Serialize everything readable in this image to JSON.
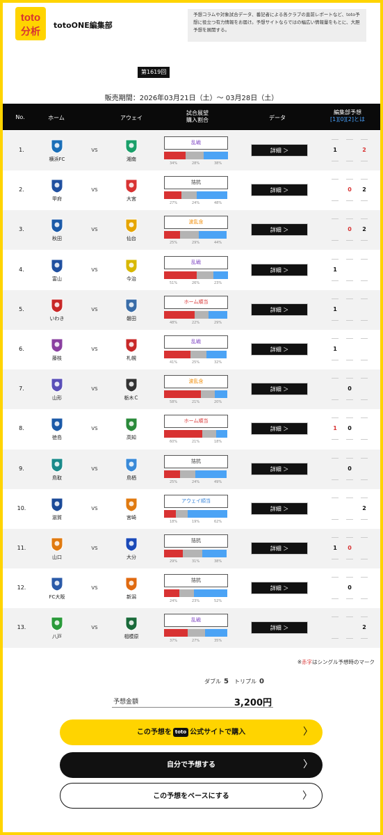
{
  "header": {
    "logo_text": "toto 分析",
    "brand": "totoONE編集部",
    "intro": "予想コラムや対象試合データ、番記者による各クラブの直前レポートなど、toto予想に役立つ有力情報をお届け。予想サイトならではの幅広い情報量をもとに、大胆予想を展開する。"
  },
  "round": "第1619回",
  "period": "販売期間：2026年03月21日（土）〜 03月28日（土）",
  "table_head": {
    "no": "No.",
    "home": "ホーム",
    "away": "アウェイ",
    "cond1": "試合展望",
    "cond2": "購入割合",
    "data": "データ",
    "pick1": "編集部予想",
    "pick2": "[1][0][2]とは"
  },
  "vs": "VS",
  "detail_label": "詳細 ＞",
  "matches": [
    {
      "no": "1.",
      "home": "横浜FC",
      "away": "湘南",
      "cond": "乱戦",
      "cond_color": "#7a3fc0",
      "pct": [
        34,
        28,
        38
      ],
      "picks": [
        "1",
        "",
        "2"
      ],
      "red": [
        false,
        false,
        true
      ],
      "home_color": "#1b6fb8",
      "away_color": "#1aa06a"
    },
    {
      "no": "2.",
      "home": "甲府",
      "away": "大宮",
      "cond": "拮抗",
      "cond_color": "#333333",
      "pct": [
        27,
        24,
        48
      ],
      "picks": [
        "",
        "0",
        "2"
      ],
      "red": [
        false,
        true,
        false
      ],
      "home_color": "#2050a0",
      "away_color": "#d83232"
    },
    {
      "no": "3.",
      "home": "秋田",
      "away": "仙台",
      "cond": "波乱含",
      "cond_color": "#f08a00",
      "pct": [
        25,
        29,
        44
      ],
      "picks": [
        "",
        "0",
        "2"
      ],
      "red": [
        false,
        true,
        false
      ],
      "home_color": "#1b5aa8",
      "away_color": "#e6a500"
    },
    {
      "no": "4.",
      "home": "富山",
      "away": "今治",
      "cond": "乱戦",
      "cond_color": "#7a3fc0",
      "pct": [
        51,
        26,
        23
      ],
      "picks": [
        "1",
        "",
        ""
      ],
      "red": [
        false,
        false,
        false
      ],
      "home_color": "#2050a0",
      "away_color": "#d8b800"
    },
    {
      "no": "5.",
      "home": "いわき",
      "away": "磐田",
      "cond": "ホーム順当",
      "cond_color": "#d83232",
      "pct": [
        48,
        22,
        29
      ],
      "picks": [
        "1",
        "",
        ""
      ],
      "red": [
        false,
        false,
        false
      ],
      "home_color": "#c82828",
      "away_color": "#3a6da8"
    },
    {
      "no": "6.",
      "home": "藤枝",
      "away": "札幌",
      "cond": "乱戦",
      "cond_color": "#7a3fc0",
      "pct": [
        41,
        25,
        32
      ],
      "picks": [
        "1",
        "",
        ""
      ],
      "red": [
        false,
        false,
        false
      ],
      "home_color": "#8a3fa0",
      "away_color": "#c82828"
    },
    {
      "no": "7.",
      "home": "山形",
      "away": "栃木Ｃ",
      "cond": "波乱含",
      "cond_color": "#f08a00",
      "pct": [
        58,
        21,
        20
      ],
      "picks": [
        "",
        "0",
        ""
      ],
      "red": [
        false,
        false,
        false
      ],
      "home_color": "#5a4fb8",
      "away_color": "#333333"
    },
    {
      "no": "8.",
      "home": "徳島",
      "away": "高知",
      "cond": "ホーム順当",
      "cond_color": "#d83232",
      "pct": [
        60,
        21,
        18
      ],
      "picks": [
        "1",
        "0",
        ""
      ],
      "red": [
        true,
        false,
        false
      ],
      "home_color": "#1b5aa8",
      "away_color": "#2a8a3a"
    },
    {
      "no": "9.",
      "home": "鳥取",
      "away": "鳥栖",
      "cond": "拮抗",
      "cond_color": "#333333",
      "pct": [
        25,
        24,
        49
      ],
      "picks": [
        "",
        "0",
        ""
      ],
      "red": [
        false,
        false,
        false
      ],
      "home_color": "#1a8a8a",
      "away_color": "#3a8ad8"
    },
    {
      "no": "10.",
      "home": "滋賀",
      "away": "宮崎",
      "cond": "アウェイ順当",
      "cond_color": "#2f7fd8",
      "pct": [
        18,
        19,
        62
      ],
      "picks": [
        "",
        "",
        "2"
      ],
      "red": [
        false,
        false,
        false
      ],
      "home_color": "#1b4a98",
      "away_color": "#e07a10"
    },
    {
      "no": "11.",
      "home": "山口",
      "away": "大分",
      "cond": "拮抗",
      "cond_color": "#333333",
      "pct": [
        29,
        31,
        38
      ],
      "picks": [
        "1",
        "0",
        ""
      ],
      "red": [
        false,
        true,
        false
      ],
      "home_color": "#e07a10",
      "away_color": "#1b4ab8"
    },
    {
      "no": "12.",
      "home": "FC大阪",
      "away": "新潟",
      "cond": "拮抗",
      "cond_color": "#333333",
      "pct": [
        24,
        23,
        52
      ],
      "picks": [
        "",
        "0",
        ""
      ],
      "red": [
        false,
        false,
        false
      ],
      "home_color": "#2a5aa8",
      "away_color": "#e06a10"
    },
    {
      "no": "13.",
      "home": "八戸",
      "away": "相模原",
      "cond": "乱戦",
      "cond_color": "#7a3fc0",
      "pct": [
        37,
        27,
        35
      ],
      "picks": [
        "",
        "",
        "2"
      ],
      "red": [
        false,
        false,
        false
      ],
      "home_color": "#2a9a3a",
      "away_color": "#1a6a3a"
    }
  ],
  "footer": {
    "note_red": "赤字",
    "note_rest": "はシングル予想時のマーク",
    "note_mark": "※",
    "double_label": "ダブル",
    "double_val": "5",
    "triple_label": "トリプル",
    "triple_val": "0",
    "amount_label": "予想金額",
    "amount_val": "3,200円",
    "buy_pre": "この予想を",
    "buy_logo": "toto",
    "buy_post": "公式サイトで購入",
    "self_label": "自分で予想する",
    "base_label": "この予想をベースにする",
    "chevron": "〉"
  }
}
